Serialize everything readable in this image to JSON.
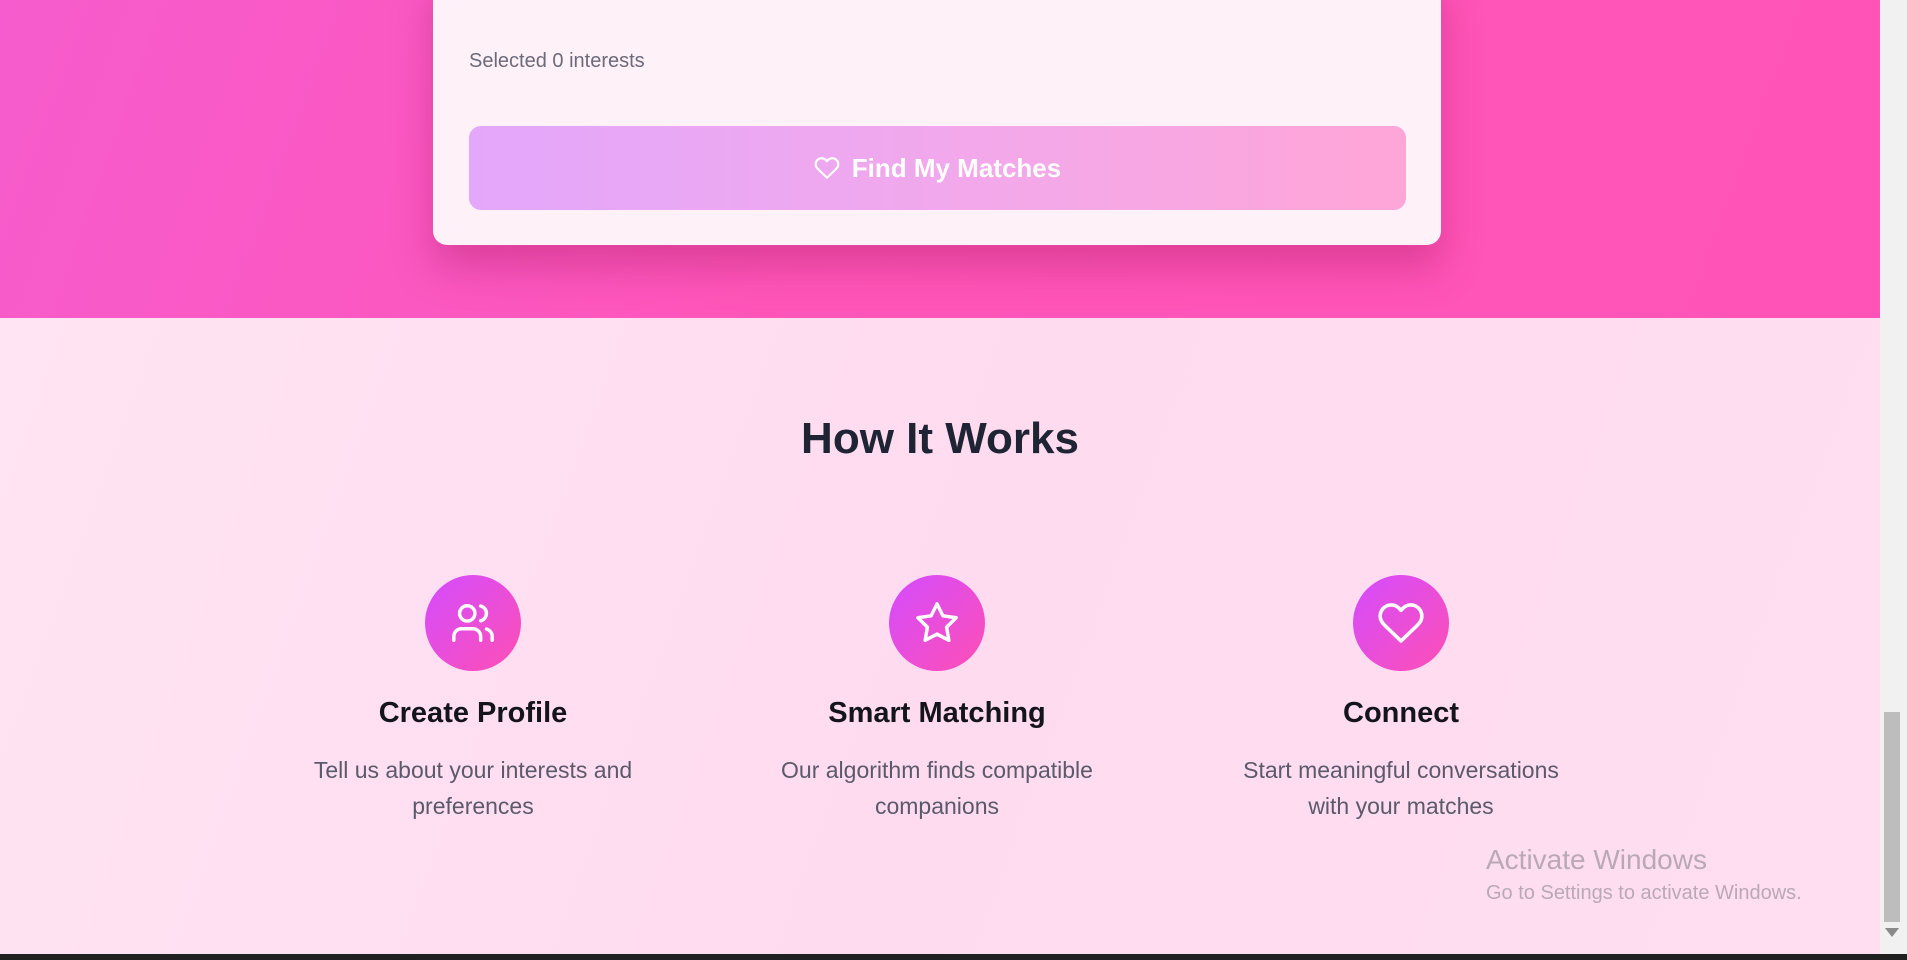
{
  "interests": {
    "chips": [
      "",
      "",
      "",
      ""
    ],
    "selected_text": "Selected 0 interests"
  },
  "find_button": {
    "label": "Find My Matches",
    "icon": "heart-outline-icon"
  },
  "how_it_works": {
    "title": "How It Works",
    "steps": [
      {
        "icon": "users-icon",
        "title": "Create Profile",
        "description": "Tell us about your interests and preferences"
      },
      {
        "icon": "star-icon",
        "title": "Smart Matching",
        "description": "Our algorithm finds compatible companions"
      },
      {
        "icon": "heart-icon",
        "title": "Connect",
        "description": "Start meaningful conversations with your matches"
      }
    ]
  },
  "watermark": {
    "title": "Activate Windows",
    "subtitle": "Go to Settings to activate Windows."
  },
  "colors": {
    "hero_pink": "#ff55b9",
    "section_bg": "#ffdff1",
    "icon_gradient_start": "#d34cff",
    "icon_gradient_end": "#ff4fb4",
    "button_gradient_start": "#e3a7fb",
    "button_gradient_end": "#ffa6d8"
  }
}
